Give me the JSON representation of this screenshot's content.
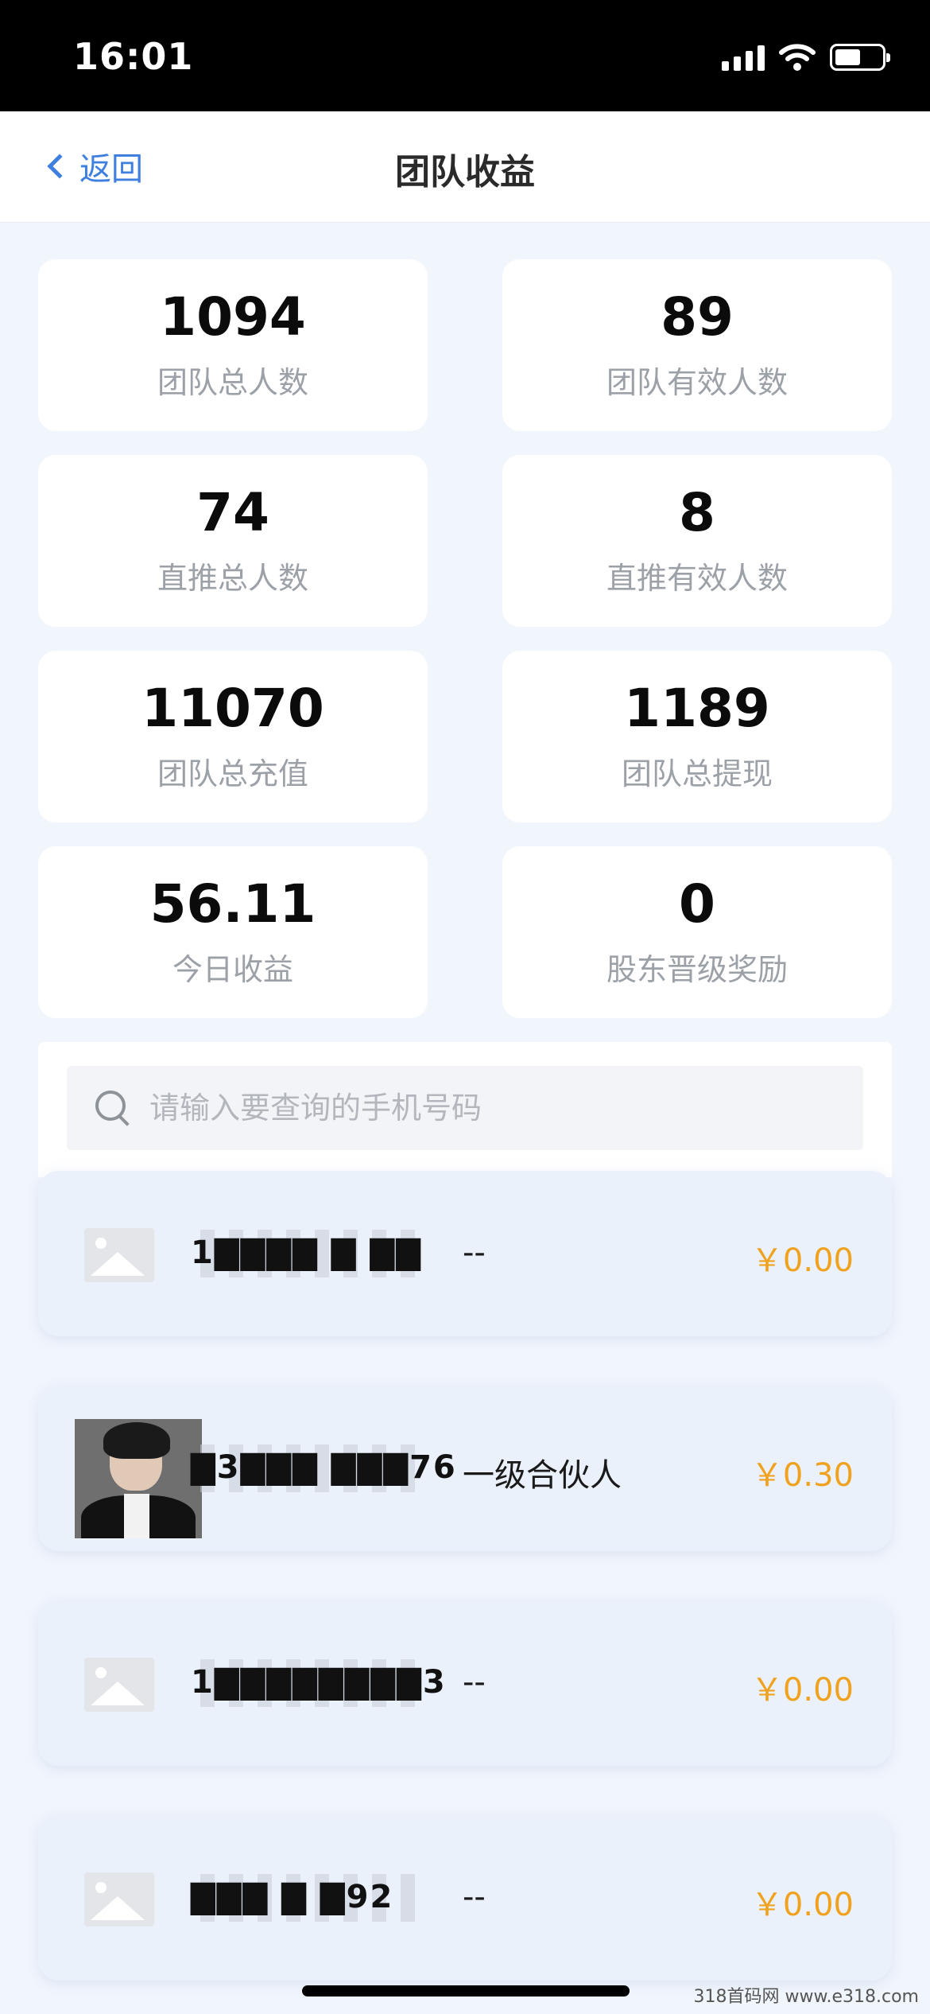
{
  "status_bar": {
    "time": "16:01"
  },
  "nav": {
    "back_label": "返回",
    "title": "团队收益"
  },
  "stats": [
    {
      "value": "1094",
      "label": "团队总人数"
    },
    {
      "value": "89",
      "label": "团队有效人数"
    },
    {
      "value": "74",
      "label": "直推总人数"
    },
    {
      "value": "8",
      "label": "直推有效人数"
    },
    {
      "value": "11070",
      "label": "团队总充值"
    },
    {
      "value": "1189",
      "label": "团队总提现"
    },
    {
      "value": "56.11",
      "label": "今日收益"
    },
    {
      "value": "0",
      "label": "股东晋级奖励"
    }
  ],
  "search": {
    "placeholder": "请输入要查询的手机号码"
  },
  "members": [
    {
      "phone": "1▇▇▇▇ ▇ ▇▇",
      "level": "--",
      "amount": "￥0.00",
      "avatar": "placeholder"
    },
    {
      "phone": "▇3▇▇▇ ▇▇▇76",
      "level": "一级合伙人",
      "amount": "￥0.30",
      "avatar": "photo"
    },
    {
      "phone": "1▇▇▇▇▇▇▇▇3",
      "level": "--",
      "amount": "￥0.00",
      "avatar": "placeholder"
    },
    {
      "phone": "▇▇▇ ▇ ▇92",
      "level": "--",
      "amount": "￥0.00",
      "avatar": "placeholder"
    }
  ],
  "watermark": "318首码网 www.e318.com",
  "colors": {
    "accent": "#3f7fe0",
    "amount": "#f0a21f",
    "background": "#f1f6fd"
  }
}
